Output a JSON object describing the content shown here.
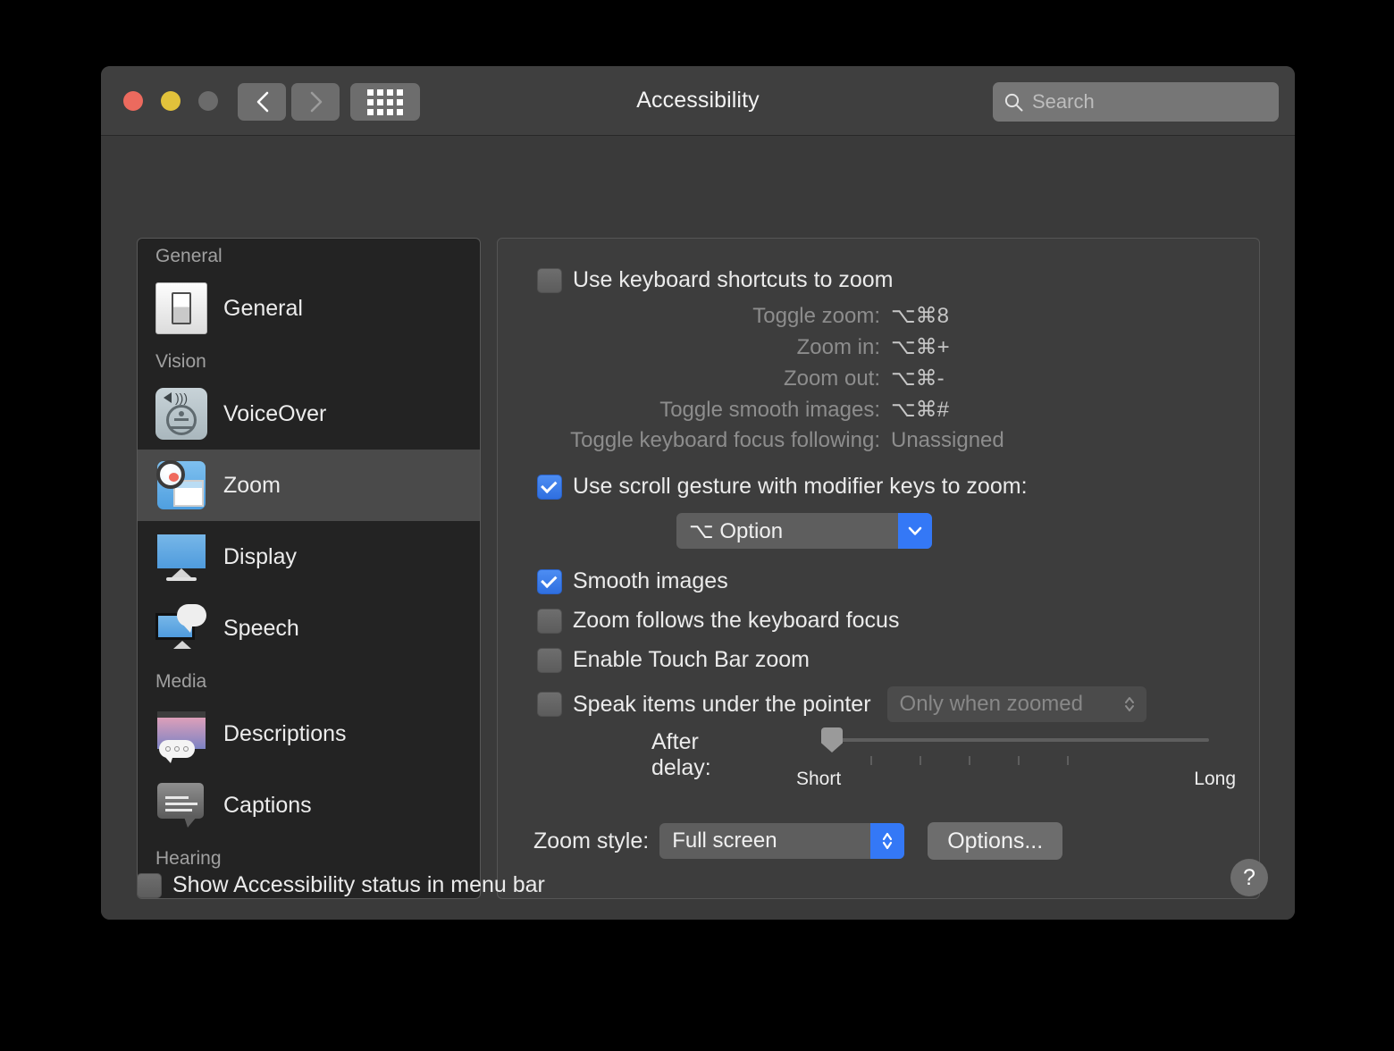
{
  "window": {
    "title": "Accessibility",
    "traffic_lights": [
      "close-button",
      "minimize-button",
      "zoom-button"
    ],
    "nav": {
      "back": "back-button",
      "forward": "forward-button",
      "show_all": "show-all-button"
    },
    "search": {
      "placeholder": "Search",
      "value": ""
    }
  },
  "sidebar": {
    "groups": [
      {
        "header": "General",
        "items": [
          {
            "label": "General",
            "icon": "general-switch-icon",
            "selected": false
          }
        ]
      },
      {
        "header": "Vision",
        "items": [
          {
            "label": "VoiceOver",
            "icon": "voiceover-icon",
            "selected": false
          },
          {
            "label": "Zoom",
            "icon": "zoom-icon",
            "selected": true
          },
          {
            "label": "Display",
            "icon": "display-icon",
            "selected": false
          },
          {
            "label": "Speech",
            "icon": "speech-icon",
            "selected": false
          }
        ]
      },
      {
        "header": "Media",
        "items": [
          {
            "label": "Descriptions",
            "icon": "descriptions-icon",
            "selected": false
          },
          {
            "label": "Captions",
            "icon": "captions-icon",
            "selected": false
          }
        ]
      },
      {
        "header": "Hearing",
        "items": []
      }
    ]
  },
  "pane": {
    "keyboard_shortcuts": {
      "label": "Use keyboard shortcuts to zoom",
      "checked": false,
      "shortcuts": [
        {
          "name": "Toggle zoom:",
          "value": "⌥⌘8"
        },
        {
          "name": "Zoom in:",
          "value": "⌥⌘+"
        },
        {
          "name": "Zoom out:",
          "value": "⌥⌘-"
        },
        {
          "name": "Toggle smooth images:",
          "value": "⌥⌘#"
        },
        {
          "name": "Toggle keyboard focus following:",
          "value": "Unassigned"
        }
      ]
    },
    "scroll_gesture": {
      "label": "Use scroll gesture with modifier keys to zoom:",
      "checked": true,
      "modifier": "⌥ Option"
    },
    "checkboxes": [
      {
        "label": "Smooth images",
        "checked": true
      },
      {
        "label": "Zoom follows the keyboard focus",
        "checked": false
      },
      {
        "label": "Enable Touch Bar zoom",
        "checked": false
      }
    ],
    "speak_items": {
      "label": "Speak items under the pointer",
      "checked": false,
      "mode": "Only when zoomed",
      "disabled": true
    },
    "after_delay": {
      "label": "After delay:",
      "short_label": "Short",
      "long_label": "Long",
      "value_percent": 0,
      "tick_count": 5
    },
    "zoom_style": {
      "label": "Zoom style:",
      "value": "Full screen",
      "options_button": "Options..."
    }
  },
  "footer": {
    "status_checkbox": {
      "label": "Show Accessibility status in menu bar",
      "checked": false
    },
    "help_glyph": "?"
  },
  "colors": {
    "accent_blue": "#3478f6",
    "window_bg": "#3a3a3a",
    "pane_bg": "#3d3d3d",
    "sidebar_bg": "#232323",
    "selected_row": "#4a4a4a",
    "close_red": "#ec6a5e",
    "minimize_yellow": "#e2c23b",
    "zoom_gray": "#6b6b6b"
  }
}
